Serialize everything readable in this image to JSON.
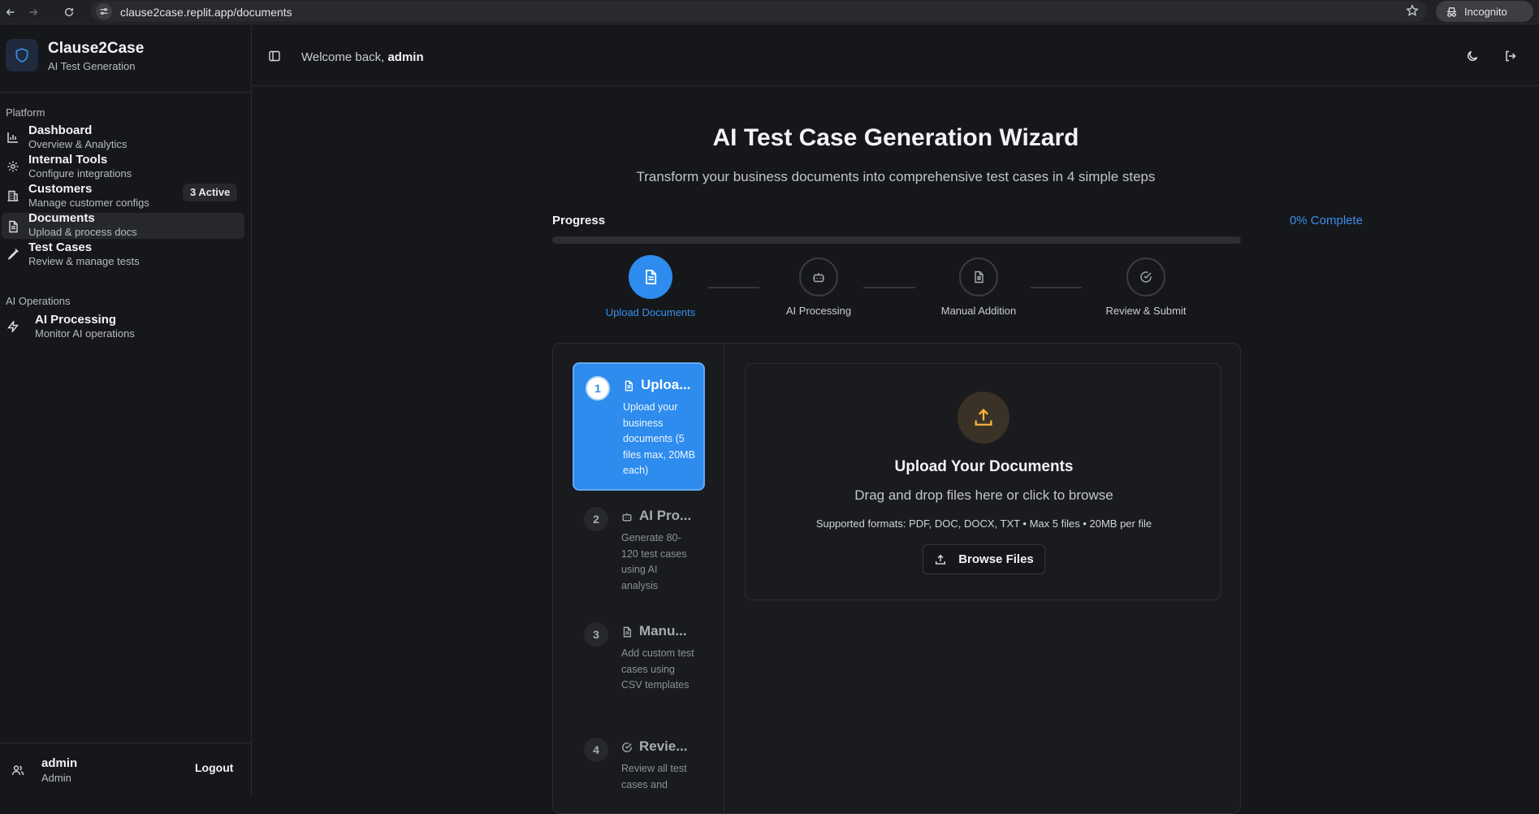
{
  "browser": {
    "url": "clause2case.replit.app/documents",
    "incognito_label": "Incognito"
  },
  "brand": {
    "name": "Clause2Case",
    "tagline": "AI Test Generation"
  },
  "sidebar": {
    "platform_label": "Platform",
    "ai_ops_label": "AI Operations",
    "items": [
      {
        "title": "Dashboard",
        "subtitle": "Overview & Analytics",
        "icon": "chart-icon"
      },
      {
        "title": "Internal Tools",
        "subtitle": "Configure integrations",
        "icon": "gear-icon",
        "badge": "3 Active"
      },
      {
        "title": "Customers",
        "subtitle": "Manage customer configs",
        "icon": "building-icon"
      },
      {
        "title": "Documents",
        "subtitle": "Upload & process docs",
        "icon": "document-icon",
        "active": true
      },
      {
        "title": "Test Cases",
        "subtitle": "Review & manage tests",
        "icon": "flask-icon"
      }
    ],
    "ai_items": [
      {
        "title": "AI Processing",
        "subtitle": "Monitor AI operations",
        "icon": "zap-icon"
      }
    ],
    "user": {
      "name": "admin",
      "role": "Admin",
      "logout_label": "Logout"
    }
  },
  "header": {
    "welcome_prefix": "Welcome back,",
    "welcome_user": "admin"
  },
  "wizard": {
    "title": "AI Test Case Generation Wizard",
    "subtitle": "Transform your business documents into comprehensive test cases in 4 simple steps",
    "progress_label": "Progress",
    "progress_text": "0% Complete",
    "progress_value": 0,
    "accent_color": "#2d8ced",
    "steps": [
      {
        "label": "Upload Documents",
        "icon": "document-icon",
        "state": "current"
      },
      {
        "label": "AI Processing",
        "icon": "bot-icon",
        "state": "pending"
      },
      {
        "label": "Manual Addition",
        "icon": "spreadsheet-icon",
        "state": "pending"
      },
      {
        "label": "Review & Submit",
        "icon": "check-circle-icon",
        "state": "pending"
      }
    ],
    "step_cards": [
      {
        "number": "1",
        "title": "Uploa...",
        "description": "Upload your business documents (5 files max, 20MB each)",
        "state": "active"
      },
      {
        "number": "2",
        "title": "AI Pro...",
        "description": "Generate 80-120 test cases using AI analysis",
        "state": "pending"
      },
      {
        "number": "3",
        "title": "Manu...",
        "description": "Add custom test cases using CSV templates",
        "state": "pending"
      },
      {
        "number": "4",
        "title": "Revie...",
        "description": "Review all test cases and",
        "state": "pending"
      }
    ]
  },
  "upload": {
    "title": "Upload Your Documents",
    "hint": "Drag and drop files here or click to browse",
    "formats": "Supported formats: PDF, DOC, DOCX, TXT • Max 5 files • 20MB per file",
    "browse_label": "Browse Files",
    "icon_color": "#f5b33c"
  }
}
